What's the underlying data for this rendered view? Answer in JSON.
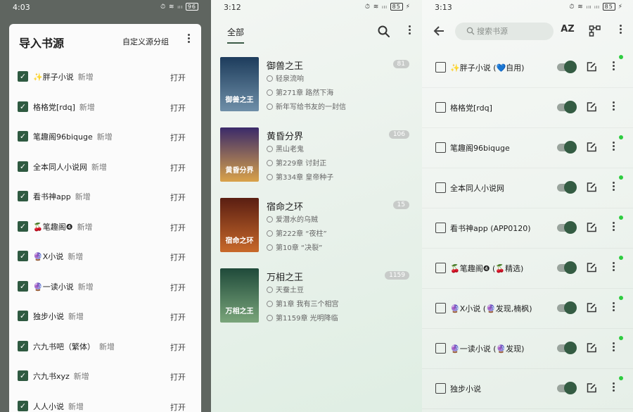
{
  "panel1": {
    "status": {
      "time": "4:03",
      "battery": "96"
    },
    "dialog": {
      "title": "导入书源",
      "group_button": "自定义源分组",
      "more_icon": "more-vert-icon",
      "items": [
        {
          "name": "✨胖子小说",
          "tag": "新增",
          "action": "打开",
          "checked": true
        },
        {
          "name": "格格党[rdq]",
          "tag": "新增",
          "action": "打开",
          "checked": true
        },
        {
          "name": "笔趣阁96biquge",
          "tag": "新增",
          "action": "打开",
          "checked": true
        },
        {
          "name": "全本同人小说网",
          "tag": "新增",
          "action": "打开",
          "checked": true
        },
        {
          "name": "看书神app",
          "tag": "新增",
          "action": "打开",
          "checked": true
        },
        {
          "name": "🍒笔趣阁❹",
          "tag": "新增",
          "action": "打开",
          "checked": true
        },
        {
          "name": "🔮X小说",
          "tag": "新增",
          "action": "打开",
          "checked": true
        },
        {
          "name": "🔮一读小说",
          "tag": "新增",
          "action": "打开",
          "checked": true
        },
        {
          "name": "独步小说",
          "tag": "新增",
          "action": "打开",
          "checked": true
        },
        {
          "name": "六九书吧（繁体）",
          "tag": "新增",
          "action": "打开",
          "checked": true
        },
        {
          "name": "六九书xyz",
          "tag": "新增",
          "action": "打开",
          "checked": true
        },
        {
          "name": "人人小说",
          "tag": "新增",
          "action": "打开",
          "checked": true
        }
      ]
    }
  },
  "panel2": {
    "status": {
      "time": "3:12",
      "battery": "85"
    },
    "tab": "全部",
    "books": [
      {
        "title": "御兽之王",
        "author": "轻泉流响",
        "latest_read": "第271章 路然下海",
        "latest": "新年写给书友的一封信",
        "count": "81",
        "cover_text": "御兽之王",
        "cover_colors": [
          "#1d3c5c",
          "#6f8fa8"
        ]
      },
      {
        "title": "黄昏分界",
        "author": "黑山老鬼",
        "latest_read": "第229章 讨封正",
        "latest": "第334章 皇帝种子",
        "count": "106",
        "cover_text": "黄昏分界",
        "cover_colors": [
          "#3a2a6a",
          "#d9a24a"
        ]
      },
      {
        "title": "宿命之环",
        "author": "爱潜水的乌贼",
        "latest_read": "第222章 “夜柱”",
        "latest": "第10章 “决裂”",
        "count": "15",
        "cover_text": "宿命之环",
        "cover_colors": [
          "#5a1e12",
          "#c8692a"
        ]
      },
      {
        "title": "万相之王",
        "author": "天蚕土豆",
        "latest_read": "第1章 我有三个相宫",
        "latest": "第1159章 光明降临",
        "count": "1159",
        "cover_text": "万相之王",
        "cover_colors": [
          "#1f4a3a",
          "#7aa57a"
        ]
      }
    ]
  },
  "panel3": {
    "status": {
      "time": "3:13",
      "battery": "85"
    },
    "search_placeholder": "搜索书源",
    "sort_label": "AZ",
    "sources": [
      {
        "name": "✨胖子小说 (💙自用)",
        "enabled": true,
        "updated": true
      },
      {
        "name": "格格党[rdq]",
        "enabled": true,
        "updated": false
      },
      {
        "name": "笔趣阁96biquge",
        "enabled": true,
        "updated": true
      },
      {
        "name": "全本同人小说网",
        "enabled": true,
        "updated": true
      },
      {
        "name": "看书神app (APP0120)",
        "enabled": true,
        "updated": true
      },
      {
        "name": "🍒笔趣阁❹ (🍒精选)",
        "enabled": true,
        "updated": true
      },
      {
        "name": "🔮X小说 (🔮发现,楠枫)",
        "enabled": true,
        "updated": true
      },
      {
        "name": "🔮一读小说 (🔮发现)",
        "enabled": true,
        "updated": true
      },
      {
        "name": "独步小说",
        "enabled": true,
        "updated": true
      }
    ]
  }
}
